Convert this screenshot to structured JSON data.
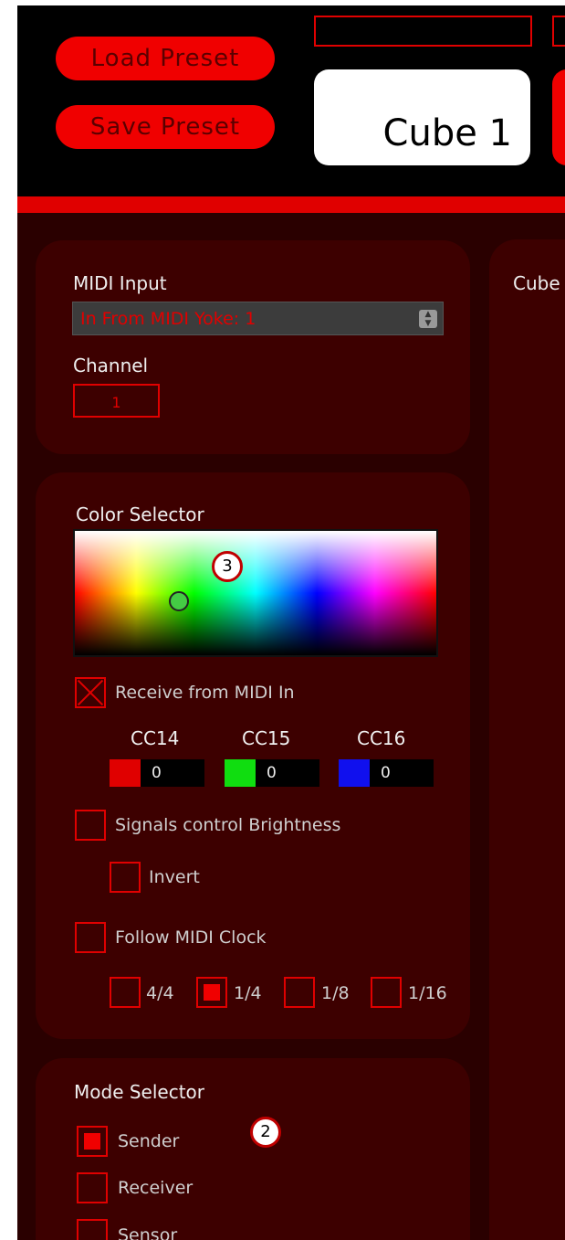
{
  "header": {
    "load_preset": "Load Preset",
    "save_preset": "Save Preset",
    "active_tab": "Cube 1"
  },
  "midi_panel": {
    "input_label": "MIDI Input",
    "input_value": "In From MIDI Yoke:  1",
    "channel_label": "Channel",
    "channel_value": "1"
  },
  "color_panel": {
    "title": "Color Selector",
    "badge": "3",
    "receive_label": "Receive from MIDI In",
    "cc": [
      {
        "label": "CC14",
        "value": "0",
        "color": "#e00000"
      },
      {
        "label": "CC15",
        "value": "0",
        "color": "#10dd10"
      },
      {
        "label": "CC16",
        "value": "0",
        "color": "#1010ee"
      }
    ],
    "brightness_label": "Signals control Brightness",
    "invert_label": "Invert",
    "clock_label": "Follow MIDI Clock",
    "clock_options": [
      "4/4",
      "1/4",
      "1/8",
      "1/16"
    ],
    "clock_selected": "1/4"
  },
  "mode_panel": {
    "title": "Mode Selector",
    "badge": "2",
    "options": [
      "Sender",
      "Receiver",
      "Sensor"
    ],
    "selected": "Sender"
  },
  "right_panel": {
    "title": "Cube"
  },
  "colors": {
    "accent": "#e00000",
    "background": "#2a0000",
    "panel": "#3d0000"
  }
}
